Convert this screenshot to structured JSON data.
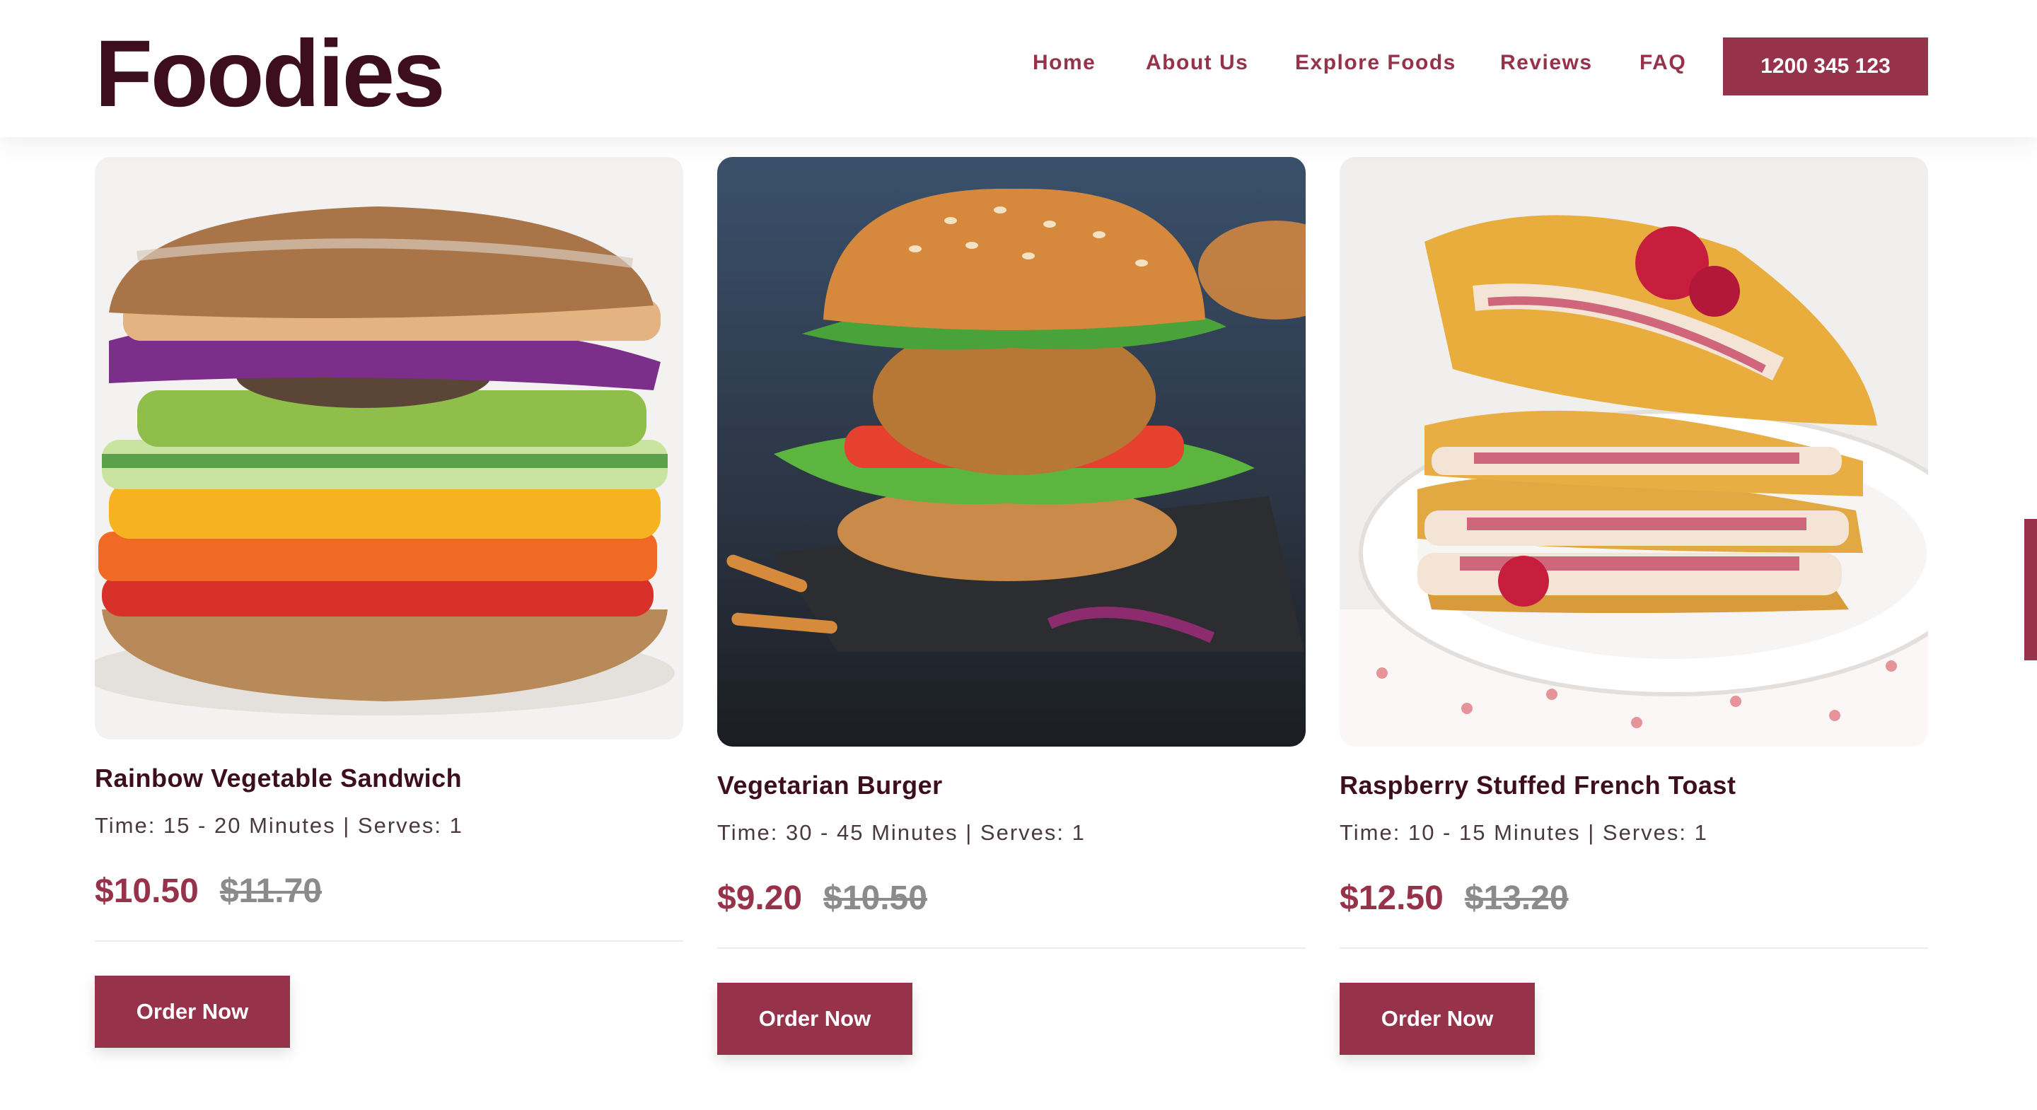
{
  "brand": {
    "name": "Foodies"
  },
  "nav": {
    "items": [
      "Home",
      "About Us",
      "Explore Foods",
      "Reviews",
      "FAQ"
    ],
    "phone": "1200 345 123"
  },
  "colors": {
    "accent": "#97324b",
    "brand_dark": "#3d0e1d"
  },
  "foods": [
    {
      "name": "Rainbow Vegetable Sandwich",
      "meta": "Time: 15 - 20 Minutes | Serves: 1",
      "price": "$10.50",
      "old_price": "$11.70",
      "button": "Order Now",
      "image": "rainbow-vegetable-sandwich-photo"
    },
    {
      "name": "Vegetarian Burger",
      "meta": "Time: 30 - 45 Minutes | Serves: 1",
      "price": "$9.20",
      "old_price": "$10.50",
      "button": "Order Now",
      "image": "vegetarian-burger-photo"
    },
    {
      "name": "Raspberry Stuffed French Toast",
      "meta": "Time: 10 - 15 Minutes | Serves: 1",
      "price": "$12.50",
      "old_price": "$13.20",
      "button": "Order Now",
      "image": "raspberry-french-toast-photo"
    }
  ]
}
